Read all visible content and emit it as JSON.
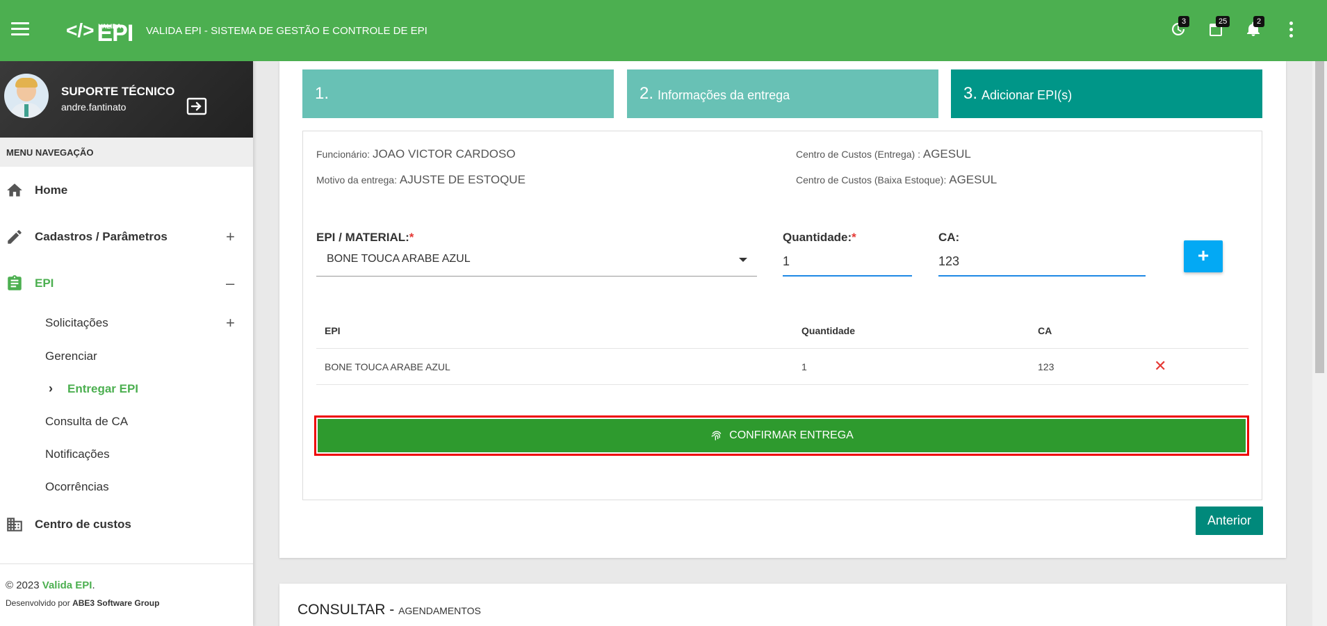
{
  "header": {
    "logo_small": "VALIDA",
    "logo_text": "EPI",
    "app_title": "VALIDA EPI - SISTEMA DE GESTÃO E CONTROLE DE EPI",
    "badges": {
      "history": "3",
      "list": "25",
      "notifications": "2"
    }
  },
  "user": {
    "name": "SUPORTE TÉCNICO",
    "login": "andre.fantinato"
  },
  "sidebar": {
    "menu_header": "MENU NAVEGAÇÃO",
    "items": [
      {
        "label": "Home",
        "icon": "home-icon"
      },
      {
        "label": "Cadastros / Parâmetros",
        "icon": "pencil-icon",
        "toggle": "+"
      },
      {
        "label": "EPI",
        "icon": "clipboard-icon",
        "toggle": "–"
      },
      {
        "label": "Centro de custos",
        "icon": "building-icon"
      }
    ],
    "sub_items": [
      {
        "label": "Solicitações",
        "toggle": "+"
      },
      {
        "label": "Gerenciar"
      },
      {
        "label": "Entregar EPI"
      },
      {
        "label": "Consulta de CA"
      },
      {
        "label": "Notificações"
      },
      {
        "label": "Ocorrências"
      }
    ],
    "footer": {
      "copy_prefix": "© 2023",
      "brand": "Valida EPI",
      "copy_suffix": ".",
      "dev_prefix": "Desenvolvido por",
      "dev_company": "ABE3 Software Group"
    }
  },
  "steps": [
    {
      "num": "1.",
      "label": ""
    },
    {
      "num": "2.",
      "label": "Informações da entrega"
    },
    {
      "num": "3.",
      "label": "Adicionar EPI(s)"
    }
  ],
  "info": {
    "funcionario_label": "Funcionário:",
    "funcionario": "JOAO VICTOR CARDOSO",
    "motivo_label": "Motivo da entrega:",
    "motivo": "AJUSTE DE ESTOQUE",
    "cc_entrega_label": "Centro de Custos (Entrega) :",
    "cc_entrega": "AGESUL",
    "cc_baixa_label": "Centro de Custos (Baixa Estoque):",
    "cc_baixa": "AGESUL"
  },
  "form": {
    "epi_label": "EPI / MATERIAL:",
    "required_mark": "*",
    "epi_value": "BONE TOUCA ARABE AZUL",
    "qtd_label": "Quantidade:",
    "qtd_value": "1",
    "ca_label": "CA:",
    "ca_value": "123",
    "add_label": "+"
  },
  "table": {
    "headers": [
      "EPI",
      "Quantidade",
      "CA"
    ],
    "rows": [
      {
        "epi": "BONE TOUCA ARABE AZUL",
        "qtd": "1",
        "ca": "123"
      }
    ],
    "delete_glyph": "✕"
  },
  "confirm_label": "CONFIRMAR ENTREGA",
  "prev_label": "Anterior",
  "consult": {
    "title": "CONSULTAR - ",
    "subtitle": "AGENDAMENTOS"
  },
  "colors": {
    "primary": "#4caf50",
    "teal": "#009688",
    "teal_light": "#68c1b5",
    "confirm": "#2e9a2e",
    "add": "#03a9f4",
    "danger": "#e53935"
  }
}
